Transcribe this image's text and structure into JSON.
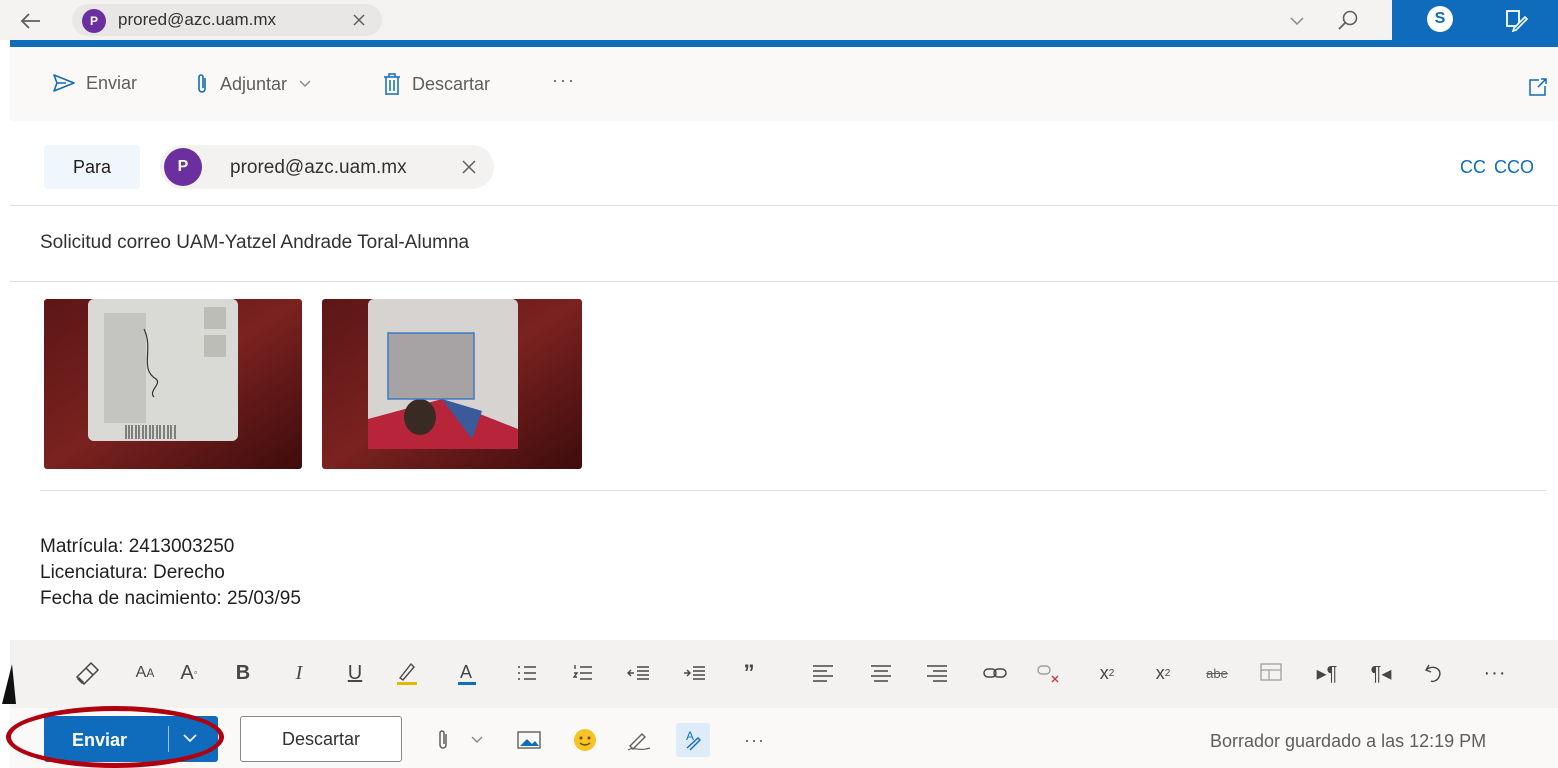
{
  "top": {
    "tab_avatar": "P",
    "tab_title": "prored@azc.uam.mx",
    "skype_letter": "S"
  },
  "commands": {
    "send": "Enviar",
    "attach": "Adjuntar",
    "discard": "Descartar",
    "more": "···"
  },
  "recipients": {
    "to_label": "Para",
    "avatar_letter": "P",
    "email": "prored@azc.uam.mx",
    "cc": "CC",
    "bcc": "CCO"
  },
  "subject": "Solicitud correo UAM-Yatzel Andrade Toral-Alumna",
  "body": {
    "lines": [
      "Matrícula: 2413003250",
      "Licenciatura: Derecho",
      "Fecha de nacimiento: 25/03/95"
    ]
  },
  "bottom": {
    "send": "Enviar",
    "discard": "Descartar",
    "more": "···",
    "status": "Borrador guardado a las 12:19 PM"
  },
  "format_toolbar": {
    "icons": [
      "format-painter-icon",
      "font-size-decrease-icon",
      "font-size-increase-icon",
      "bold-icon",
      "italic-icon",
      "underline-icon",
      "highlight-icon",
      "font-color-icon",
      "bullets-icon",
      "numbering-icon",
      "decrease-indent-icon",
      "increase-indent-icon",
      "quote-icon",
      "align-left-icon",
      "align-center-icon",
      "align-right-icon",
      "link-icon",
      "unlink-icon",
      "superscript-icon",
      "subscript-icon",
      "strikethrough-icon",
      "insert-table-icon",
      "ltr-icon",
      "rtl-icon",
      "undo-icon",
      "more-icon"
    ]
  },
  "colors": {
    "accent": "#0f6cbd",
    "avatar": "#6b2fa0",
    "highlight_ring": "#b00010"
  }
}
